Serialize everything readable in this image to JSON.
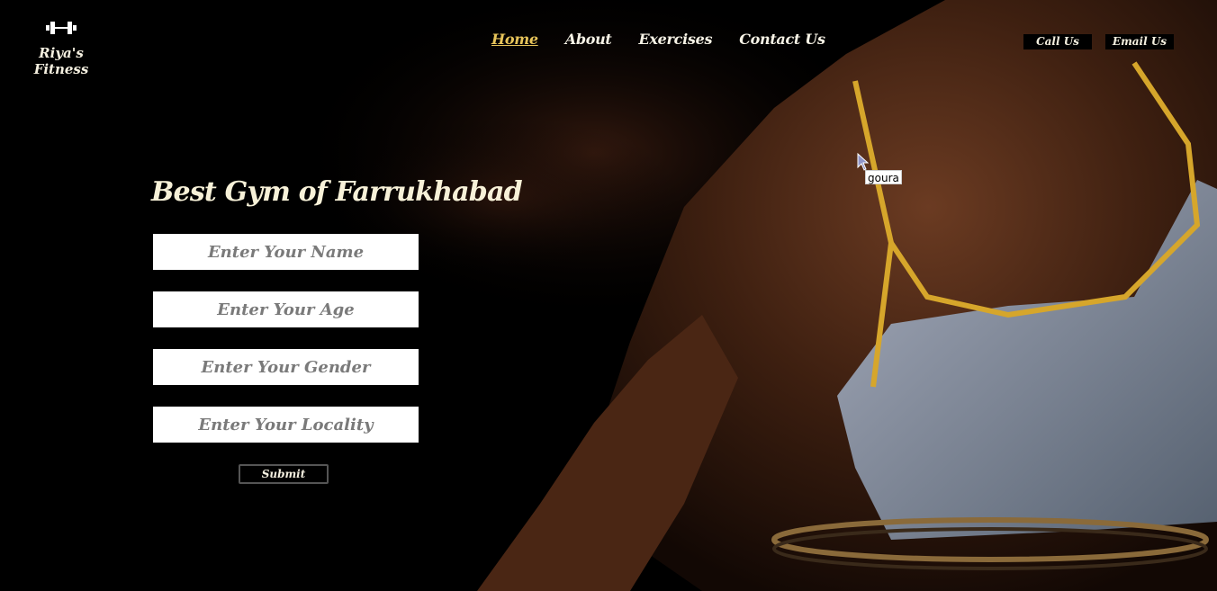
{
  "brand": {
    "name": "Riya's Fitness",
    "icon": "dumbbell-icon"
  },
  "nav": {
    "items": [
      {
        "label": "Home",
        "active": true
      },
      {
        "label": "About",
        "active": false
      },
      {
        "label": "Exercises",
        "active": false
      },
      {
        "label": "Contact Us",
        "active": false
      }
    ]
  },
  "actions": {
    "call_label": "Call Us",
    "email_label": "Email Us"
  },
  "form": {
    "title": "Best Gym of Farrukhabad",
    "name_placeholder": "Enter Your Name",
    "age_placeholder": "Enter Your Age",
    "gender_placeholder": "Enter Your Gender",
    "locality_placeholder": "Enter Your Locality",
    "submit_label": "Submit"
  },
  "tooltip": {
    "text": "goura"
  },
  "colors": {
    "accent": "#e7c45a",
    "text": "#f7f3e6",
    "background": "#000000"
  }
}
